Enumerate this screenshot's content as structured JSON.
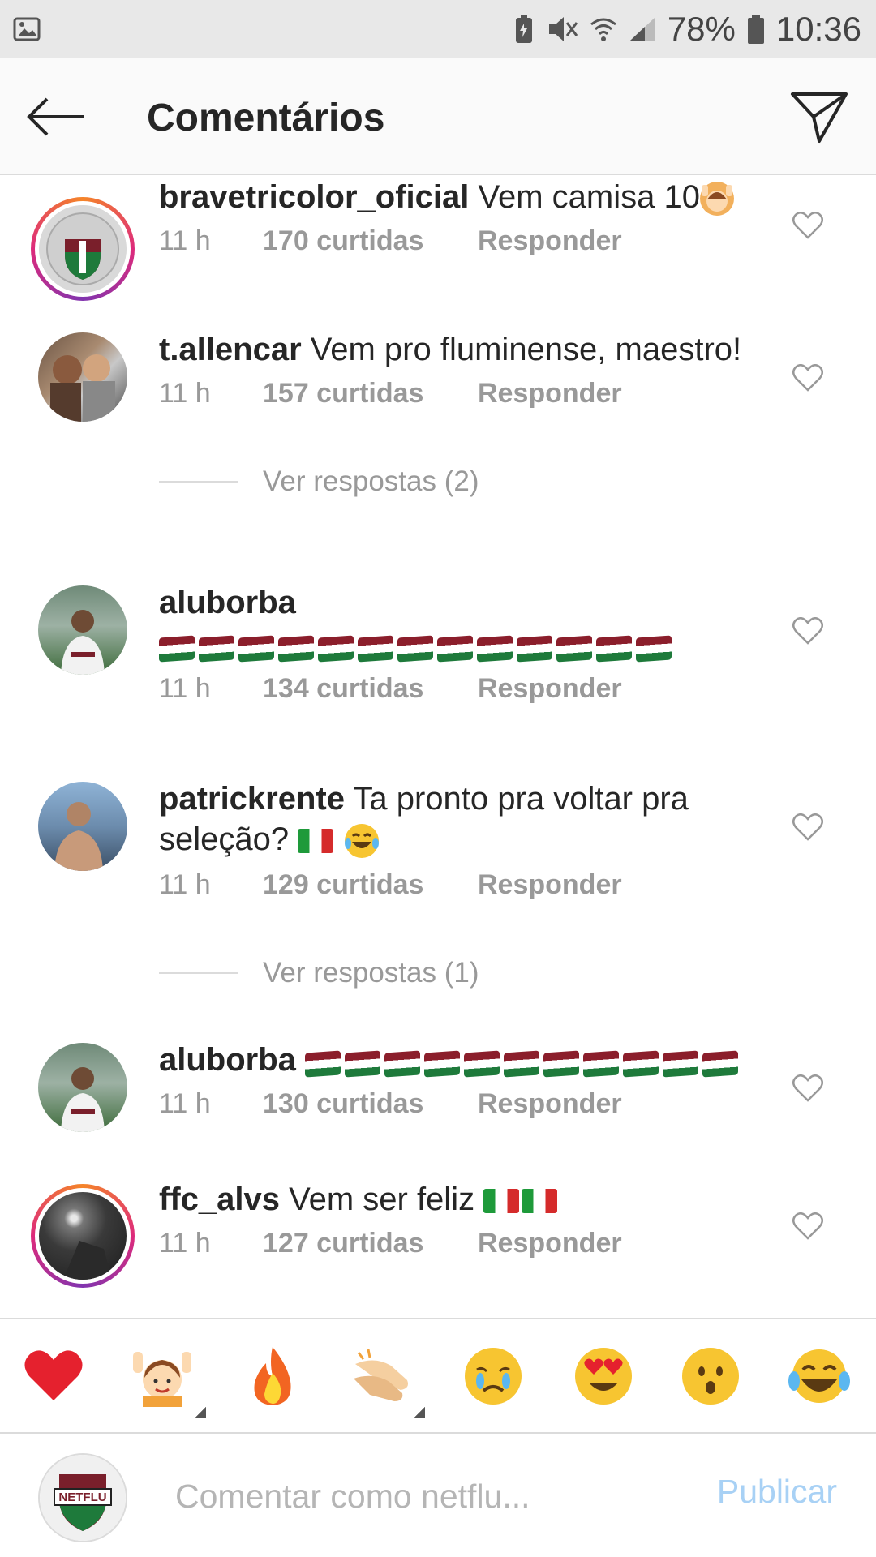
{
  "status_bar": {
    "battery": "78%",
    "time": "10:36"
  },
  "header": {
    "title": "Comentários"
  },
  "comments": [
    {
      "username": "bravetricolor_oficial",
      "text": "Vem camisa 10",
      "time": "11 h",
      "likes": "170 curtidas",
      "reply": "Responder",
      "avatar": "brave-tricolor-crest"
    },
    {
      "username": "t.allencar",
      "text": "Vem pro fluminense, maestro!",
      "time": "11 h",
      "likes": "157 curtidas",
      "reply": "Responder",
      "view_replies": "Ver respostas (2)",
      "avatar": "photo-couple"
    },
    {
      "username": "aluborba",
      "text": "",
      "flag_count": 13,
      "time": "11 h",
      "likes": "134 curtidas",
      "reply": "Responder",
      "avatar": "photo-player"
    },
    {
      "username": "patrickrente",
      "text": "Ta pronto pra voltar pra",
      "text_line2": "seleção?",
      "time": "11 h",
      "likes": "129 curtidas",
      "reply": "Responder",
      "view_replies": "Ver respostas (1)",
      "avatar": "photo-man-beach"
    },
    {
      "username": "aluborba",
      "text": "",
      "flag_count": 11,
      "time": "11 h",
      "likes": "130 curtidas",
      "reply": "Responder",
      "avatar": "photo-player"
    },
    {
      "username": "ffc_alvs",
      "text": "Vem ser feliz",
      "time": "11 h",
      "likes": "127 curtidas",
      "reply": "Responder",
      "avatar": "photo-dark"
    }
  ],
  "emoji_bar": [
    "heart",
    "raising-hands-person",
    "fire",
    "clapping-hands",
    "crying-face",
    "heart-eyes",
    "surprised-face",
    "tears-of-joy"
  ],
  "input": {
    "placeholder": "Comentar como netflu...",
    "publish_label": "Publicar",
    "avatar_text": "NETFLU"
  },
  "colors": {
    "flu_maroon": "#8b1e2b",
    "flu_green": "#1e7a3b",
    "publish_disabled": "#a8d1f5",
    "secondary_text": "#999999"
  }
}
